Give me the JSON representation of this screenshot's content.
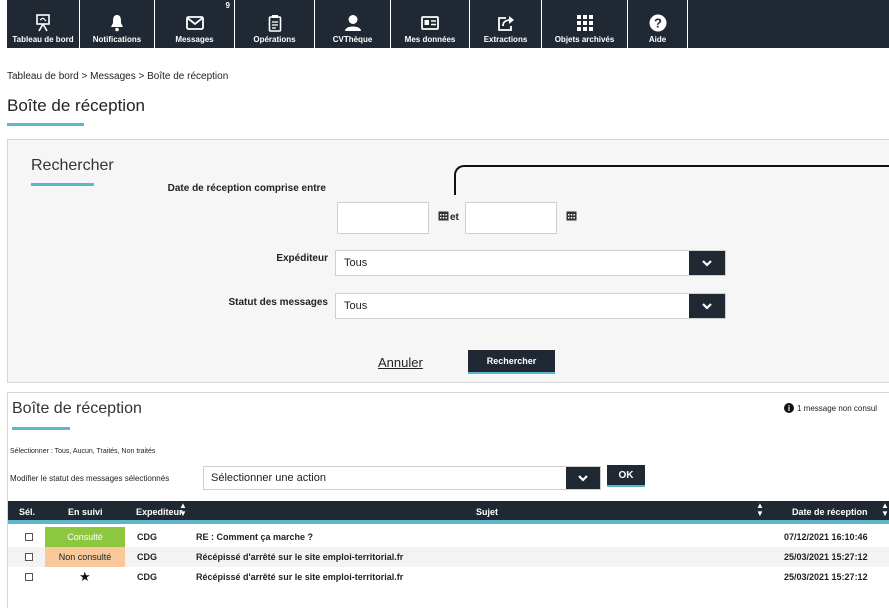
{
  "nav": {
    "items": [
      {
        "label": "Tableau de bord",
        "icon": "dashboard-icon"
      },
      {
        "label": "Notifications",
        "icon": "bell-icon"
      },
      {
        "label": "Messages",
        "icon": "envelope-icon",
        "badge": "9"
      },
      {
        "label": "Opérations",
        "icon": "clipboard-icon"
      },
      {
        "label": "CVThèque",
        "icon": "user-icon"
      },
      {
        "label": "Mes données",
        "icon": "id-card-icon"
      },
      {
        "label": "Extractions",
        "icon": "export-icon"
      },
      {
        "label": "Objets archivés",
        "icon": "archive-grid-icon"
      },
      {
        "label": "Aide",
        "icon": "help-icon"
      }
    ]
  },
  "breadcrumb": "Tableau de bord > Messages > Boîte de réception",
  "page_title": "Boîte de réception",
  "search": {
    "title": "Rechercher",
    "date_label": "Date de réception comprise entre",
    "date_from": "",
    "and_label": "et",
    "date_to": "",
    "sender_label": "Expéditeur",
    "sender_value": "Tous",
    "status_label": "Statut des messages",
    "status_value": "Tous",
    "cancel_label": "Annuler",
    "submit_label": "Rechercher"
  },
  "inbox": {
    "title": "Boîte de réception",
    "unread_info": "1 message non consul",
    "select_links": "Sélectionner : Tous, Aucun, Traités, Non traités",
    "modify_label": "Modifier le statut des messages sélectionnés",
    "action_placeholder": "Sélectionner une action",
    "ok_label": "OK",
    "columns": {
      "sel": "Sél.",
      "suivi": "En suivi",
      "sender": "Expediteur",
      "subject": "Sujet",
      "date": "Date de réception"
    },
    "rows": [
      {
        "status": "Consulté",
        "status_color": "#8dc63f",
        "sender": "CDG",
        "subject": "RE : Comment ça marche ?",
        "date": "07/12/2021 16:10:46"
      },
      {
        "status": "Non consulté",
        "status_color": "#f9c99b",
        "sender": "CDG",
        "subject": "Récépissé d'arrêté sur le site emploi-territorial.fr",
        "date": "25/03/2021 15:27:12"
      },
      {
        "status": "",
        "starred": true,
        "sender": "CDG",
        "subject": "Récépissé d'arrêté sur le site emploi-territorial.fr",
        "date": "25/03/2021 15:27:12"
      }
    ]
  },
  "colors": {
    "nav_bg": "#1f2833",
    "accent": "#5bb8cc"
  }
}
